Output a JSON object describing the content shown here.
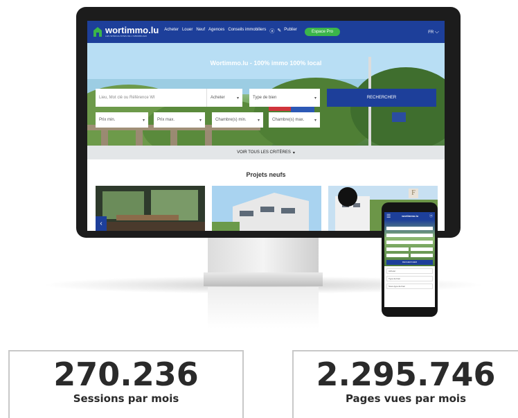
{
  "site": {
    "logo_text": "wortimmo.lu",
    "logo_tagline": "LES SPÉCIALISTES DE L'IMMOBILIER",
    "nav": [
      "Acheter",
      "Louer",
      "Neuf",
      "Agences",
      "Conseils immobiliers"
    ],
    "publish_label": "Publier",
    "pro_label": "Espace Pro",
    "lang": "FR",
    "tagline": "Wortimmo.lu - 100% immo 100% local",
    "search": {
      "location_placeholder": "Lieu, Mot clé ou Référence WI",
      "transaction": "Acheter",
      "property_type": "Type de bien",
      "submit": "RECHERCHER",
      "price_min": "Prix min.",
      "price_max": "Prix max.",
      "rooms_min": "Chambre(s) min.",
      "rooms_max": "Chambre(s) max.",
      "all_criteria": "VOIR TOUS LES CRITÈRES"
    },
    "section_title": "Projets neufs",
    "card_badge": "F"
  },
  "phone": {
    "rows": [
      "Acheter",
      "Type de bien",
      "Sous-type de bien"
    ],
    "search_label": "RECHERCHER"
  },
  "stats": [
    {
      "value": "270.236",
      "label": "Sessions par mois"
    },
    {
      "value": "2.295.746",
      "label": "Pages vues par mois"
    }
  ],
  "colors": {
    "brand_blue": "#1d3f9a",
    "pro_green": "#3bb54a"
  }
}
